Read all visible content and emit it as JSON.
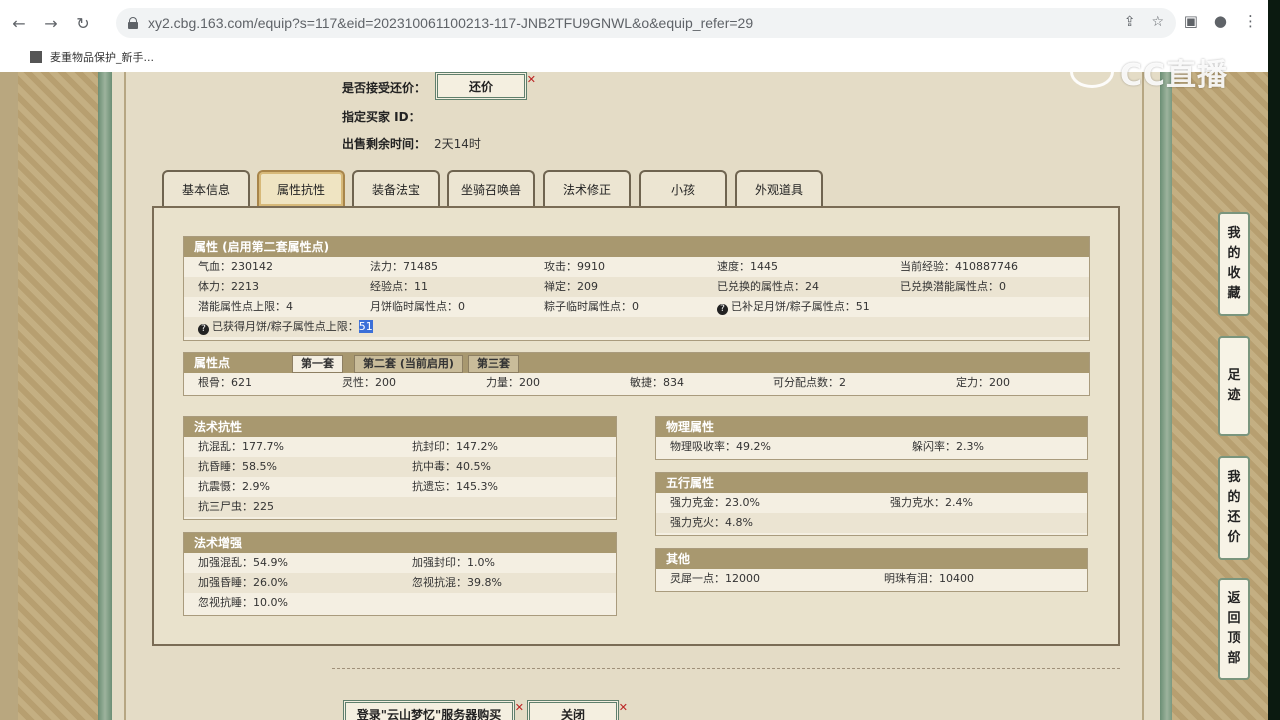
{
  "browser": {
    "url": "xy2.cbg.163.com/equip?s=117&eid=202310061100213-117-JNB2TFU9GNWL&o&equip_refer=29",
    "bookmark": "麦重物品保护_新手..."
  },
  "watermark": "CC直播",
  "offer": {
    "accept_label": "是否接受还价：",
    "counter_btn": "还价",
    "buyer_label": "指定买家 ID：",
    "buyer_value": "",
    "remaining_label": "出售剩余时间：",
    "remaining_value": "2天14时"
  },
  "tabs": [
    "基本信息",
    "属性抗性",
    "装备法宝",
    "坐骑召唤兽",
    "法术修正",
    "小孩",
    "外观道具"
  ],
  "attributes": {
    "title": "属性 (启用第二套属性点)",
    "rows": [
      [
        "气血：230142",
        "法力：71485",
        "攻击：9910",
        "速度：1445",
        "当前经验：410887746"
      ],
      [
        "体力：2213",
        "经验点：11",
        "禅定：209",
        "已兑换的属性点：24",
        "已兑换潜能属性点：0"
      ],
      [
        "潜能属性点上限：4",
        "月饼临时属性点：0",
        "粽子临时属性点：0",
        "已补足月饼/粽子属性点：51"
      ]
    ],
    "row4_label": "已获得月饼/粽子属性点上限：",
    "row4_value": "51"
  },
  "points": {
    "title": "属性点",
    "subtabs": [
      "第一套",
      "第二套 (当前启用)",
      "第三套"
    ],
    "values": [
      "根骨：621",
      "灵性：200",
      "力量：200",
      "敏捷：834",
      "可分配点数：2",
      "定力：200"
    ]
  },
  "resist": {
    "title": "法术抗性",
    "rows": [
      [
        "抗混乱：177.7%",
        "抗封印：147.2%"
      ],
      [
        "抗昏睡：58.5%",
        "抗中毒：40.5%"
      ],
      [
        "抗震慑：2.9%",
        "抗遗忘：145.3%"
      ],
      [
        "抗三尸虫：225",
        ""
      ]
    ]
  },
  "enhance": {
    "title": "法术增强",
    "rows": [
      [
        "加强混乱：54.9%",
        "加强封印：1.0%"
      ],
      [
        "加强昏睡：26.0%",
        "忽视抗混：39.8%"
      ],
      [
        "忽视抗睡：10.0%",
        ""
      ]
    ]
  },
  "physical": {
    "title": "物理属性",
    "rows": [
      [
        "物理吸收率：49.2%",
        "躲闪率：2.3%"
      ]
    ]
  },
  "elements": {
    "title": "五行属性",
    "rows": [
      [
        "强力克金：23.0%",
        "强力克水：2.4%"
      ],
      [
        "强力克火：4.8%",
        ""
      ]
    ]
  },
  "other": {
    "title": "其他",
    "rows": [
      [
        "灵犀一点：12000",
        "明珠有泪：10400"
      ]
    ]
  },
  "bottom": {
    "login_btn": "登录\"云山梦忆\"服务器购买",
    "close_btn": "关闭"
  },
  "sidebar": [
    [
      "我",
      "的",
      "收",
      "藏"
    ],
    [
      "足",
      "迹"
    ],
    [
      "我",
      "的",
      "还",
      "价"
    ],
    [
      "返",
      "回",
      "顶",
      "部"
    ]
  ]
}
